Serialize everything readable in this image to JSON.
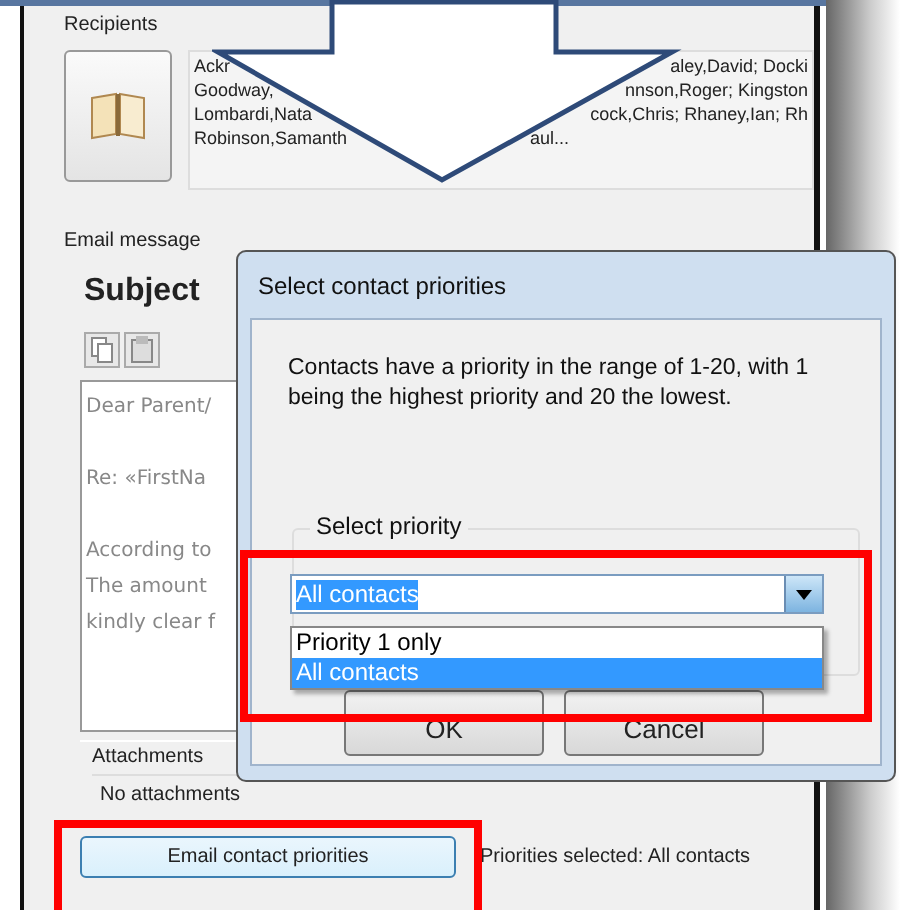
{
  "recipients": {
    "label": "Recipients",
    "lines": [
      {
        "left": "Ackr",
        "right": "aley,David;  Docki"
      },
      {
        "left": "Goodway,",
        "right": "nnson,Roger;  Kingston"
      },
      {
        "left": "Lombardi,Nata",
        "right": "cock,Chris;  Rhaney,Ian;  Rh"
      },
      {
        "left": "Robinson,Samanth",
        "right": "aul..."
      }
    ]
  },
  "email_message": {
    "label": "Email message",
    "subject_label": "Subject",
    "body_paragraphs": [
      [
        "Dear Parent/"
      ],
      [
        "Re: «FirstNa"
      ],
      [
        "According to",
        "The amount",
        "kindly clear f"
      ]
    ],
    "attachments": {
      "label": "Attachments",
      "value": "No attachments"
    }
  },
  "footer": {
    "button": "Email contact priorities",
    "status": "Priorities selected:  All contacts"
  },
  "dialog": {
    "title": "Select contact priorities",
    "message": "Contacts have a priority in the range of 1-20, with 1 being the highest priority and 20 the lowest.",
    "group_label": "Select priority",
    "combo_value": "All contacts",
    "options": [
      {
        "label": "Priority 1 only",
        "selected": false
      },
      {
        "label": "All contacts",
        "selected": true
      }
    ],
    "buttons": [
      "OK",
      "Cancel"
    ]
  }
}
